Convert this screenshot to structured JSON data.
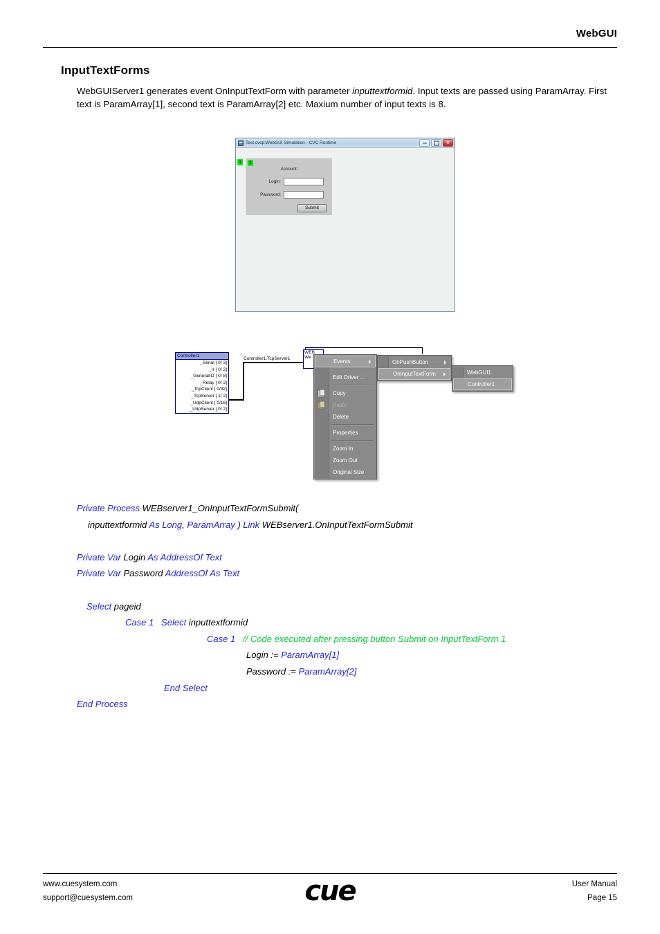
{
  "header": {
    "title": "WebGUI"
  },
  "section": {
    "heading": "InputTextForms",
    "paragraph_pre": "WebGUIServer1 generates event OnInputTextForm with parameter ",
    "paragraph_em": "inputtextformid",
    "paragraph_post": ". Input texts are passed using ParamArray. First text is ParamArray[1], second text is ParamArray[2] etc. Maxium number of input texts is 8."
  },
  "sim_window": {
    "title": "Test.cvcp:WebGUI Simulation - CVC Runtime",
    "window_badge": "1",
    "buttons": {
      "minimize": "minimize-button",
      "maximize": "maximize-button",
      "close": "close-button"
    },
    "form": {
      "badge": "1",
      "caption": "Account:",
      "login_label": "Login:",
      "login_value": "",
      "password_label": "Password:",
      "password_value": "",
      "submit_label": "Submit"
    }
  },
  "diagram": {
    "controller": {
      "title": "Controller1",
      "ports": [
        "_Serial [ 0/ 3]",
        "_Ir [ 0/ 2]",
        "_GeneralIO [ 0/ 8]",
        "_Relay [ 0/ 2]",
        "_TcpClient [ 0/32]",
        "_TcpServer [ 1/ 2]",
        "_UdpClient [ 0/16]",
        "_UdpServer [ 0/ 2]"
      ]
    },
    "link_label": "Controller1.TcpServer1",
    "web_node": {
      "title": "WEB",
      "port": "We"
    },
    "context_menu": [
      {
        "label": "Events",
        "submenu": true,
        "disabled": false,
        "highlight": true,
        "icon": null
      },
      {
        "separator": true
      },
      {
        "label": "Edit Driver ...",
        "submenu": false,
        "disabled": false,
        "highlight": false,
        "icon": null
      },
      {
        "separator": true
      },
      {
        "label": "Copy",
        "submenu": false,
        "disabled": false,
        "highlight": false,
        "icon": "copy-icon"
      },
      {
        "label": "Paste",
        "submenu": false,
        "disabled": true,
        "highlight": false,
        "icon": "paste-icon"
      },
      {
        "label": "Delete",
        "submenu": false,
        "disabled": false,
        "highlight": false,
        "icon": null
      },
      {
        "separator": true
      },
      {
        "label": "Properties",
        "submenu": false,
        "disabled": false,
        "highlight": false,
        "icon": null
      },
      {
        "separator": true
      },
      {
        "label": "Zoom In",
        "submenu": false,
        "disabled": false,
        "highlight": false,
        "icon": null
      },
      {
        "label": "Zoom Out",
        "submenu": false,
        "disabled": false,
        "highlight": false,
        "icon": null
      },
      {
        "label": "Original Size",
        "submenu": false,
        "disabled": false,
        "highlight": false,
        "icon": null
      }
    ],
    "events_submenu": [
      {
        "label": "OnPushButton",
        "submenu": true,
        "highlight": false
      },
      {
        "label": "OnInputTextForm",
        "submenu": true,
        "highlight": true
      }
    ],
    "targets_submenu": [
      {
        "label": "WebGUI1",
        "highlight": false
      },
      {
        "label": "Controller1",
        "highlight": true
      }
    ]
  },
  "code": {
    "lines": [
      {
        "indent": 0,
        "parts": [
          {
            "t": "Private Process ",
            "c": "kw"
          },
          {
            "t": "WEBserver1_OnInputTextFormSubmit(",
            "c": ""
          }
        ]
      },
      {
        "indent": 16,
        "parts": [
          {
            "t": "inputtextformid ",
            "c": ""
          },
          {
            "t": "As Long",
            "c": "kw"
          },
          {
            "t": ", ",
            "c": ""
          },
          {
            "t": "ParamArray",
            "c": "kw"
          },
          {
            "t": " ) ",
            "c": ""
          },
          {
            "t": "Link",
            "c": "kw"
          },
          {
            "t": " WEBserver1.OnInputTextFormSubmit",
            "c": ""
          }
        ]
      },
      {
        "indent": 0,
        "parts": [
          {
            "t": " ",
            "c": ""
          }
        ]
      },
      {
        "indent": 0,
        "parts": [
          {
            "t": "Private Var",
            "c": "kw"
          },
          {
            "t": " Login ",
            "c": ""
          },
          {
            "t": "As AddressOf Text",
            "c": "kw"
          }
        ]
      },
      {
        "indent": 0,
        "parts": [
          {
            "t": "Private Var",
            "c": "kw"
          },
          {
            "t": " Password ",
            "c": ""
          },
          {
            "t": "AddressOf As Text",
            "c": "kw"
          }
        ]
      },
      {
        "indent": 0,
        "parts": [
          {
            "t": " ",
            "c": ""
          }
        ]
      },
      {
        "indent": 14,
        "parts": [
          {
            "t": "Select",
            "c": "kw"
          },
          {
            "t": " pageid",
            "c": ""
          }
        ]
      },
      {
        "indent": 70,
        "parts": [
          {
            "t": "Case 1",
            "c": "kw"
          },
          {
            "t": "   ",
            "c": ""
          },
          {
            "t": "Select",
            "c": "kw"
          },
          {
            "t": " inputtextformid",
            "c": ""
          }
        ]
      },
      {
        "indent": 188,
        "parts": [
          {
            "t": "Case 1",
            "c": "kw"
          },
          {
            "t": "   ",
            "c": ""
          },
          {
            "t": "// Code executed after pressing button Submit on InputTextForm 1",
            "c": "cm"
          }
        ]
      },
      {
        "indent": 245,
        "parts": [
          {
            "t": "Login := ",
            "c": ""
          },
          {
            "t": "ParamArray[1]",
            "c": "kw"
          }
        ]
      },
      {
        "indent": 245,
        "parts": [
          {
            "t": "Password := ",
            "c": ""
          },
          {
            "t": "ParamArray[2]",
            "c": "kw"
          }
        ]
      },
      {
        "indent": 126,
        "parts": [
          {
            "t": "End Select",
            "c": "kw"
          }
        ]
      },
      {
        "indent": 0,
        "parts": [
          {
            "t": "End Process",
            "c": "kw"
          }
        ]
      }
    ]
  },
  "footer": {
    "website": "www.cuesystem.com",
    "email": "support@cuesystem.com",
    "logo": "cue",
    "doc_type": "User Manual",
    "page": "Page 15"
  }
}
